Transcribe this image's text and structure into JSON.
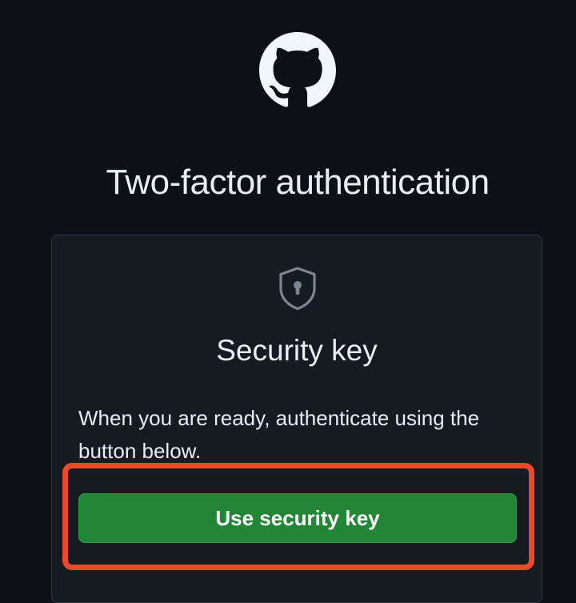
{
  "page": {
    "title": "Two-factor authentication"
  },
  "card": {
    "title": "Security key",
    "description": "When you are ready, authenticate using the button below.",
    "button_label": "Use security key"
  },
  "icons": {
    "logo": "github-octocat-icon",
    "card_icon": "shield-lock-icon"
  },
  "colors": {
    "background": "#0d1117",
    "card_background": "#161b22",
    "card_border": "#30363d",
    "primary_button": "#238636",
    "highlight_outline": "#ea4a2a",
    "text": "#e6edf3",
    "icon_muted": "#7d8590"
  }
}
